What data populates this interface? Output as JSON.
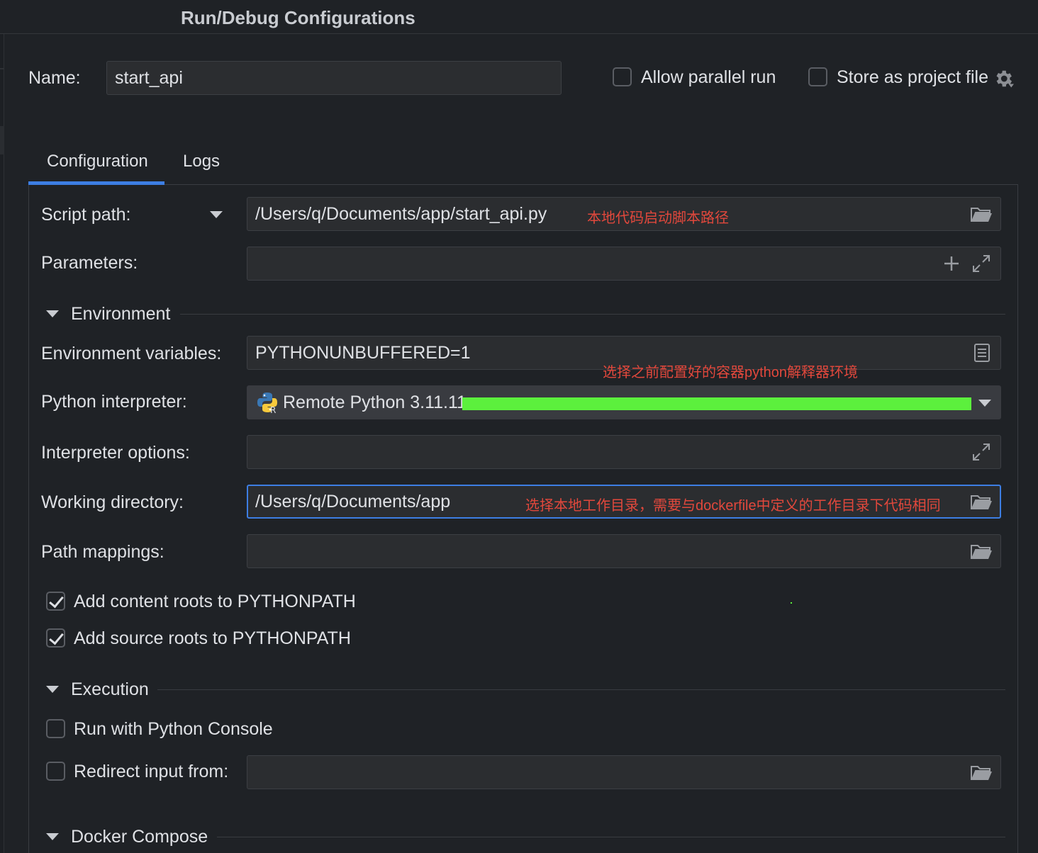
{
  "window": {
    "title": "Run/Debug Configurations"
  },
  "header": {
    "name_label": "Name:",
    "name_value": "start_api",
    "allow_parallel_label": "Allow parallel run",
    "allow_parallel_checked": false,
    "store_project_label": "Store as project file",
    "store_project_checked": false
  },
  "tabs": [
    {
      "label": "Configuration",
      "active": true
    },
    {
      "label": "Logs",
      "active": false
    }
  ],
  "config": {
    "script_path_label": "Script path:",
    "script_path_value": "/Users/q/Documents/app/start_api.py",
    "script_path_note": "本地代码启动脚本路径",
    "parameters_label": "Parameters:",
    "parameters_value": "",
    "environment_section": "Environment",
    "env_vars_label": "Environment variables:",
    "env_vars_value": "PYTHONUNBUFFERED=1",
    "interpreter_note": "选择之前配置好的容器python解释器环境",
    "interpreter_label": "Python interpreter:",
    "interpreter_value": "Remote Python 3.11.11",
    "interp_options_label": "Interpreter options:",
    "interp_options_value": "",
    "working_dir_label": "Working directory:",
    "working_dir_value": "/Users/q/Documents/app",
    "working_dir_note": "选择本地工作目录，需要与dockerfile中定义的工作目录下代码相同",
    "path_mappings_label": "Path mappings:",
    "path_mappings_value": "",
    "content_roots_label": "Add content roots to PYTHONPATH",
    "content_roots_checked": true,
    "source_roots_label": "Add source roots to PYTHONPATH",
    "source_roots_checked": true,
    "execution_section": "Execution",
    "python_console_label": "Run with Python Console",
    "python_console_checked": false,
    "redirect_label": "Redirect input from:",
    "redirect_checked": false,
    "redirect_value": "",
    "docker_section": "Docker Compose"
  },
  "colors": {
    "accent": "#3d7ee3",
    "annotation": "#e2483c",
    "redaction": "#5cf03d",
    "background": "#1f2226",
    "field": "#2b2d30"
  }
}
